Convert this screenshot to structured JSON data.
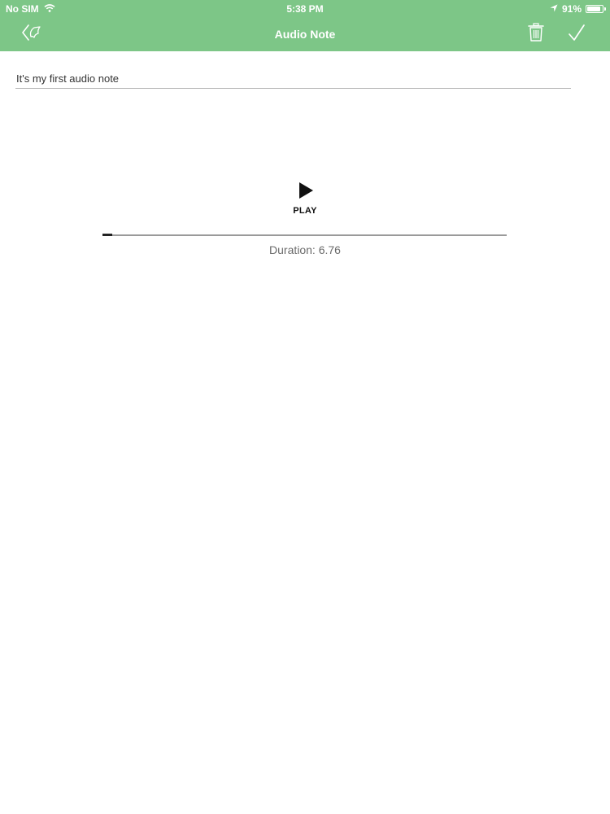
{
  "status_bar": {
    "carrier": "No SIM",
    "time": "5:38 PM",
    "battery_text": "91%",
    "battery_level": 0.91
  },
  "nav": {
    "title": "Audio Note",
    "back_icon": "back-arrow-icon",
    "trash_icon": "trash-icon",
    "done_icon": "checkmark-icon"
  },
  "note": {
    "title_value": "It's my first audio note"
  },
  "player": {
    "play_label": "PLAY",
    "duration_text": "Duration: 6.76",
    "progress": 0.025
  },
  "colors": {
    "header_green": "#7dc687",
    "background": "#ffffff"
  }
}
